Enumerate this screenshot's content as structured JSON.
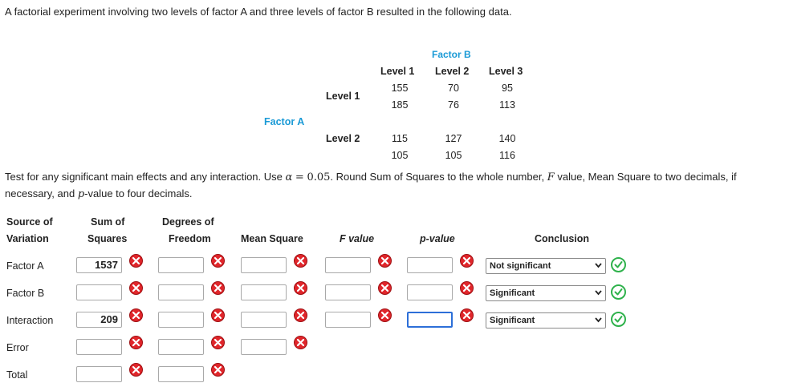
{
  "intro": "A factorial experiment involving two levels of factor A and three levels of factor B resulted in the following data.",
  "table": {
    "factor_b_label": "Factor B",
    "factor_a_label": "Factor A",
    "col_headers": [
      "Level 1",
      "Level 2",
      "Level 3"
    ],
    "row_headers": [
      "Level 1",
      "Level 2"
    ],
    "rows": [
      [
        [
          "155",
          "185"
        ],
        [
          "70",
          "76"
        ],
        [
          "95",
          "113"
        ]
      ],
      [
        [
          "115",
          "105"
        ],
        [
          "127",
          "105"
        ],
        [
          "140",
          "116"
        ]
      ]
    ]
  },
  "instructions": {
    "part1": "Test for any significant main effects and any interaction. Use",
    "alpha_symbol": "α",
    "equals": "=",
    "alpha_value": "0.05",
    "part2": ". Round Sum of Squares to the whole number,",
    "f_symbol": "F",
    "part3": "value, Mean Square to two decimals, if",
    "line2_part1": "necessary, and",
    "p_symbol": "p",
    "line2_part2": "-value to four decimals."
  },
  "anova": {
    "headers": {
      "source_line1": "Source of",
      "source_line2": "Variation",
      "ss_line1": "Sum of",
      "ss_line2": "Squares",
      "df_line1": "Degrees of",
      "df_line2": "Freedom",
      "ms": "Mean Square",
      "f": "F value",
      "p": "p-value",
      "conclusion": "Conclusion"
    },
    "rows": [
      {
        "source": "Factor A",
        "ss": "1537",
        "df": "",
        "ms": "",
        "f": "",
        "p": "",
        "conclusion": "Not significant"
      },
      {
        "source": "Factor B",
        "ss": "",
        "df": "",
        "ms": "",
        "f": "",
        "p": "",
        "conclusion": "Significant"
      },
      {
        "source": "Interaction",
        "ss": "209",
        "df": "",
        "ms": "",
        "f": "",
        "p": "",
        "conclusion": "Significant"
      },
      {
        "source": "Error",
        "ss": "",
        "df": ""
      },
      {
        "source": "Total",
        "ss": "",
        "df": ""
      }
    ]
  },
  "icons": {
    "incorrect": "x-circle-icon",
    "correct": "check-circle-icon",
    "dropdown": "chevron-down-icon"
  },
  "colors": {
    "factor_label": "#1a9ad6",
    "incorrect": "#e0262b",
    "correct": "#2fb24c",
    "focus_border": "#2d6fd8"
  }
}
